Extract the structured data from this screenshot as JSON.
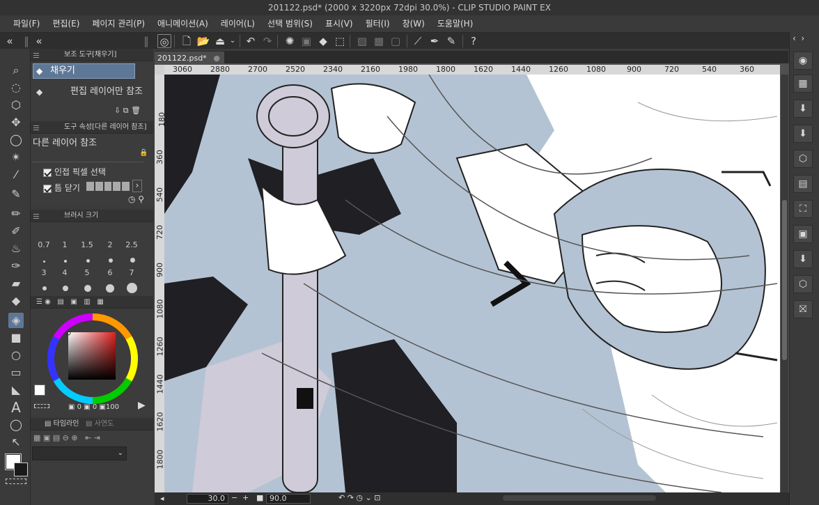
{
  "window": {
    "title": "201122.psd* (2000 x 3220px 72dpi 30.0%)  - CLIP STUDIO PAINT EX"
  },
  "menu": [
    "파일(F)",
    "편집(E)",
    "페이지 관리(P)",
    "애니메이션(A)",
    "레이어(L)",
    "선택 범위(S)",
    "표시(V)",
    "필터(I)",
    "창(W)",
    "도움말(H)"
  ],
  "subtool_panel": {
    "header": "보조 도구[채우기]",
    "items": [
      "채우기",
      "편집 레이어만 참조"
    ]
  },
  "tool_property": {
    "header": "도구 속성[다른 레이어 참조]",
    "title": "다른 레이어 참조",
    "options": [
      "인접 픽셀 선택",
      "틈 닫기"
    ]
  },
  "brush_size": {
    "header": "브러시 크기",
    "values": [
      "0.7",
      "1",
      "1.5",
      "2",
      "2.5",
      "3",
      "4",
      "5",
      "6",
      "7"
    ]
  },
  "color": {
    "main": "#ffffff",
    "sub": "#1a1a1a",
    "readouts": [
      "0",
      "0",
      "100"
    ]
  },
  "timeline": {
    "tabs": [
      "타임라인",
      "사연도"
    ]
  },
  "document": {
    "tab_name": "201122.psd*"
  },
  "ruler": {
    "horizontal": [
      "3060",
      "2880",
      "2700",
      "2520",
      "2340",
      "2160",
      "1980",
      "1800",
      "1620",
      "1440",
      "1260",
      "1080",
      "900",
      "720",
      "540",
      "360"
    ],
    "vertical": [
      "180",
      "360",
      "540",
      "720",
      "900",
      "1080",
      "1260",
      "1440",
      "1620",
      "1800"
    ]
  },
  "status": {
    "zoom": "30.0",
    "angle": "90.0"
  },
  "icons": {
    "toolbar": [
      "new-icon",
      "open-icon",
      "save-icon",
      "undo-icon",
      "redo-icon",
      "loading-icon",
      "fill-icon",
      "transform-icon",
      "selection-icon",
      "ruler-icon",
      "pen-icon",
      "help-icon"
    ],
    "tools": [
      "zoom-icon",
      "rotate-icon",
      "object-icon",
      "move-icon",
      "lasso-icon",
      "magic-wand-icon",
      "eyedropper-icon",
      "pen-icon",
      "pencil-icon",
      "brush-icon",
      "airbrush-icon",
      "decoration-icon",
      "eraser-icon",
      "blend-icon",
      "fill-icon",
      "gradient-icon",
      "figure-icon",
      "frame-icon",
      "ruler-icon",
      "text-icon",
      "balloon-icon",
      "line-correction-icon"
    ],
    "right": [
      "navigator-icon",
      "layer-icon",
      "material-icon",
      "material2-icon",
      "cube-icon",
      "page-icon",
      "crop-icon",
      "export-icon",
      "import-icon",
      "3d-icon",
      "gift-icon"
    ]
  },
  "colors": {
    "accent": "#5f7796",
    "art_blue": "#b4c3d3",
    "art_lilac": "#cfcbd8"
  }
}
